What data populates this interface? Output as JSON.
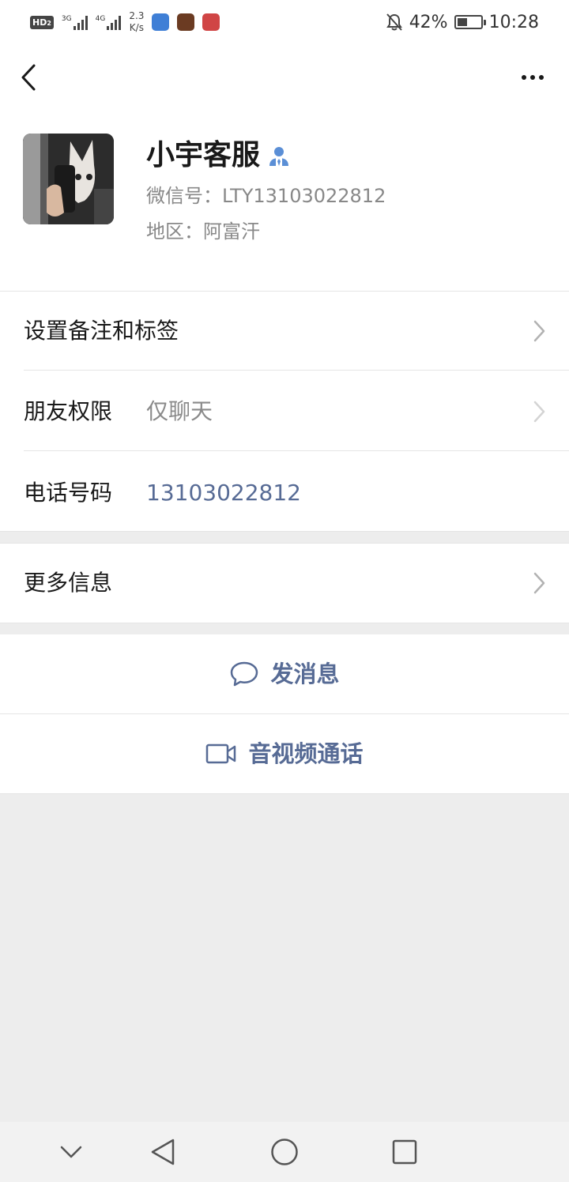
{
  "status_bar": {
    "hd_label": "HD",
    "hd_sub": "2",
    "net1": "3G",
    "net2": "4G",
    "speed_value": "2.3",
    "speed_unit": "K/s",
    "battery_percent": "42%",
    "battery_level": 0.42,
    "time": "10:28",
    "icons": [
      "hd-icon",
      "signal-icon",
      "signal-icon",
      "app-icon",
      "app-icon",
      "app-icon",
      "bell-off-icon",
      "battery-icon"
    ]
  },
  "nav": {
    "back_icon": "chevron-left-icon",
    "more_icon": "more-dots-icon"
  },
  "profile": {
    "name": "小宇客服",
    "badge_icon": "person-icon",
    "wechat_id": "微信号：LTY13103022812",
    "region": "地区：阿富汗"
  },
  "rows": {
    "remark": {
      "label": "设置备注和标签"
    },
    "permission": {
      "label": "朋友权限",
      "value": "仅聊天"
    },
    "phone": {
      "label": "电话号码",
      "value": "13103022812"
    },
    "more_info": {
      "label": "更多信息"
    }
  },
  "actions": {
    "message": {
      "label": "发消息",
      "icon": "chat-bubble-icon"
    },
    "call": {
      "label": "音视频通话",
      "icon": "video-camera-icon"
    }
  },
  "system_nav": {
    "icons": [
      "chevron-down-icon",
      "triangle-back-icon",
      "circle-home-icon",
      "square-recents-icon"
    ]
  },
  "colors": {
    "link": "#576b95",
    "background": "#ededed",
    "badge": "#5b8fd6"
  }
}
